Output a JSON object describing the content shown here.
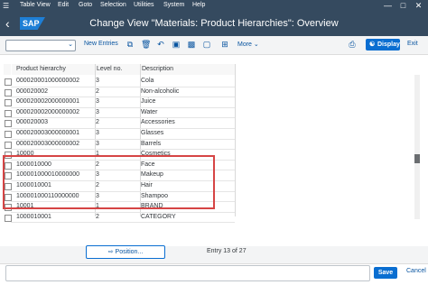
{
  "menubar": {
    "items": [
      "Table View",
      "Edit",
      "Goto",
      "Selection",
      "Utilities",
      "System",
      "Help"
    ]
  },
  "titlebar": {
    "logo": "SAP",
    "title": "Change View \"Materials: Product Hierarchies\": Overview"
  },
  "toolbar": {
    "new_entries": "New Entries",
    "more": "More",
    "display": "Display",
    "exit": "Exit"
  },
  "table": {
    "headers": [
      "Product hierarchy",
      "Level no.",
      "Description"
    ],
    "rows": [
      {
        "hierarchy": "000020001000000002",
        "level": "3",
        "description": "Cola"
      },
      {
        "hierarchy": "000020002",
        "level": "2",
        "description": "Non-alcoholic"
      },
      {
        "hierarchy": "000020002000000001",
        "level": "3",
        "description": "Juice"
      },
      {
        "hierarchy": "000020002000000002",
        "level": "3",
        "description": "Water"
      },
      {
        "hierarchy": "000020003",
        "level": "2",
        "description": "Accessories"
      },
      {
        "hierarchy": "000020003000000001",
        "level": "3",
        "description": "Glasses"
      },
      {
        "hierarchy": "000020003000000002",
        "level": "3",
        "description": "Barrels"
      },
      {
        "hierarchy": "10000",
        "level": "1",
        "description": "Cosmetics"
      },
      {
        "hierarchy": "1000010000",
        "level": "2",
        "description": "Face"
      },
      {
        "hierarchy": "100001000010000000",
        "level": "3",
        "description": "Makeup"
      },
      {
        "hierarchy": "1000010001",
        "level": "2",
        "description": "Hair"
      },
      {
        "hierarchy": "100001000110000000",
        "level": "3",
        "description": "Shampoo"
      },
      {
        "hierarchy": "10001",
        "level": "1",
        "description": "BRAND"
      },
      {
        "hierarchy": "1000010001",
        "level": "2",
        "description": "CATEGORY"
      }
    ]
  },
  "position_button": "Position...",
  "entry_info": "Entry 13 of 27",
  "footer": {
    "save": "Save",
    "cancel": "Cancel"
  },
  "colors": {
    "shell": "#354a5f",
    "accent": "#0a6ed1",
    "highlight": "#d64545"
  }
}
